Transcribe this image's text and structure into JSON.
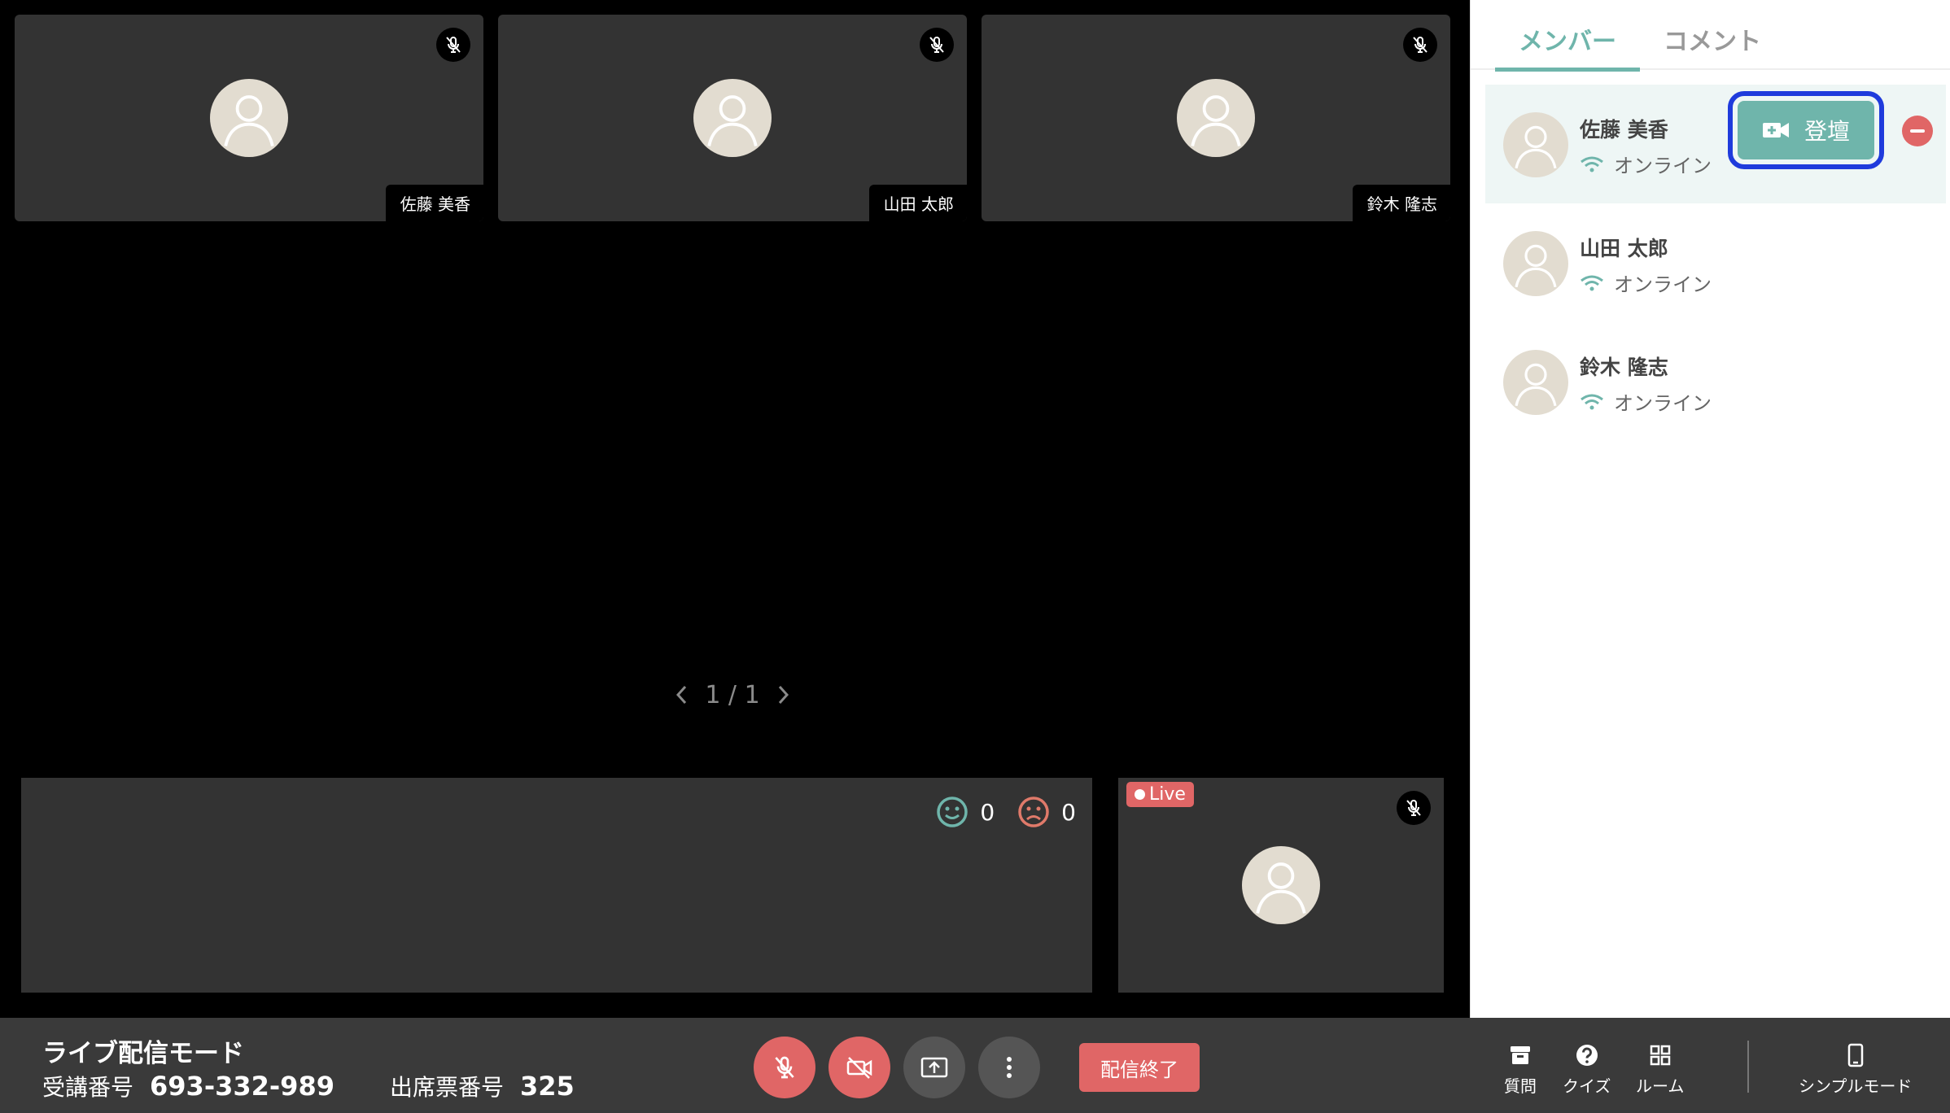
{
  "participants": [
    {
      "name": "佐藤 美香"
    },
    {
      "name": "山田 太郎"
    },
    {
      "name": "鈴木 隆志"
    }
  ],
  "pager": {
    "text": "1 / 1"
  },
  "reactions": {
    "smile_count": "0",
    "frown_count": "0"
  },
  "self_view": {
    "live_label": "Live"
  },
  "sidebar": {
    "tabs": [
      {
        "label": "メンバー",
        "active": true
      },
      {
        "label": "コメント",
        "active": false
      }
    ],
    "members": [
      {
        "name": "佐藤 美香",
        "status": "オンライン"
      },
      {
        "name": "山田 太郎",
        "status": "オンライン"
      },
      {
        "name": "鈴木 隆志",
        "status": "オンライン"
      }
    ],
    "stage_up_label": "登壇"
  },
  "bottom": {
    "mode_title": "ライブ配信モード",
    "session_label": "受講番号",
    "session_number": "693-332-989",
    "attendance_label": "出席票番号",
    "attendance_number": "325",
    "end_label": "配信終了",
    "tools": {
      "question": "質問",
      "quiz": "クイズ",
      "room": "ルーム",
      "simple_mode": "シンプルモード"
    }
  },
  "colors": {
    "accent": "#6fb5ab",
    "danger": "#e06666",
    "highlight_outline": "#1f3bdc",
    "tile_bg": "#333333"
  }
}
